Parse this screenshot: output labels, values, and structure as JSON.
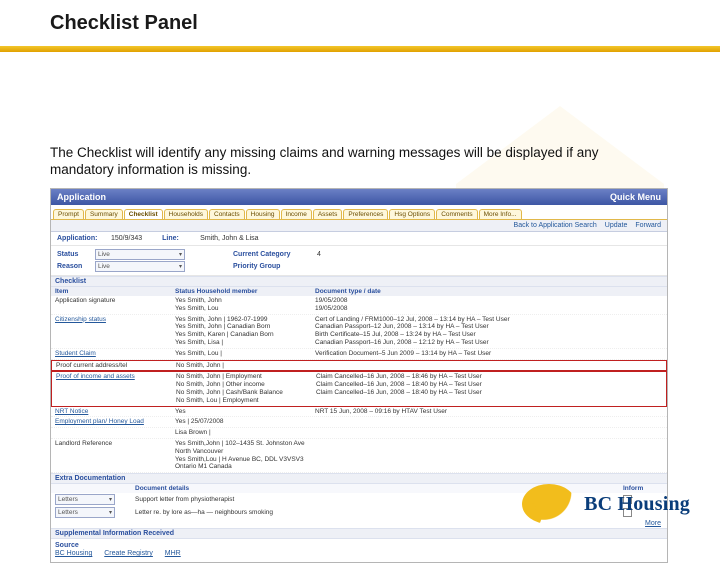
{
  "slide": {
    "title": "Checklist Panel",
    "description": "The Checklist will identify any missing claims and warning messages will be displayed if any mandatory information is missing."
  },
  "app": {
    "header_title": "Application",
    "header_right": "Quick Menu",
    "tabs": [
      "Prompt",
      "Summary",
      "Checklist",
      "Households",
      "Contacts",
      "Housing",
      "Income",
      "Assets",
      "Preferences",
      "Hsg Options",
      "Comments",
      "More Info..."
    ],
    "active_tab_index": 2,
    "actions": {
      "back": "Back to Application Search",
      "update": "Update",
      "forward": "Forward"
    },
    "meta": {
      "application_label": "Application:",
      "application_value": "150/9/343",
      "line_label": "Line:",
      "line_value": "Smith, John & Lisa"
    },
    "status": {
      "status_label": "Status",
      "status_value": "Live",
      "reason_label": "Reason",
      "reason_value": "Live",
      "category_label": "Current Category",
      "category_value": "4",
      "priority_label": "Priority Group"
    },
    "checklist": {
      "title": "Checklist",
      "headers": [
        "Item",
        "Status  Household member",
        "Document type / date"
      ],
      "rows": [
        {
          "item": "Application signature",
          "col2": [
            "Yes     Smith, John",
            "Yes     Smith, Lou"
          ],
          "col3": [
            "19/05/2008",
            "19/05/2008"
          ]
        },
        {
          "item": "Citizenship status",
          "link": true,
          "col2": [
            "Yes     Smith, John | 1962-07-1999",
            "Yes     Smith, John | Canadian Born",
            "Yes     Smith, Karen | Canadian Born",
            "Yes     Smith, Lisa |"
          ],
          "col3": [
            "Cert of Landing / FRM1000–12 Jul, 2008 – 13:14 by  HA – Test User",
            "Canadian Passport–12 Jun, 2008 – 13:14 by  HA – Test User",
            "Birth Certificate–15 Jul, 2008 – 13:24 by  HA – Test User",
            "Canadian Passport–16 Jun, 2008 – 12:12 by  HA – Test User"
          ]
        },
        {
          "item": "Student Claim",
          "link": true,
          "col2": [
            "Yes     Smith, Lou |"
          ],
          "col3": [
            "Verification Document–5 Jun 2009 – 13:14 by  HA – Test User"
          ]
        },
        {
          "item": "Proof current address/tel",
          "highlight": true,
          "col2": [
            "No      Smith, John |"
          ],
          "col3": []
        },
        {
          "item": "Proof of income and assets",
          "link": true,
          "highlight": true,
          "col2": [
            "No      Smith, John | Employment",
            "No      Smith, John | Other income",
            "No      Smith, John | Cash/Bank Balance",
            "No      Smith, Lou | Employment"
          ],
          "col3": [
            "Claim Cancelled–16 Jun, 2008 – 18:46 by  HA – Test User",
            "",
            "Claim Cancelled–16 Jun, 2008 – 18:40 by  HA – Test User",
            "Claim Cancelled–16 Jun, 2008 – 18:40 by  HA – Test User"
          ]
        },
        {
          "item": "NRT Notice",
          "link": true,
          "col2": [
            "Yes"
          ],
          "col3": [
            "NRT     15 Jun, 2008 – 09:16 by  HTAV  Test User"
          ]
        },
        {
          "item": "Employment plan/ Honey Load",
          "link": true,
          "col2": [
            "Yes        | 25/07/2008"
          ],
          "col3": []
        },
        {
          "item": "",
          "col2": [
            "Lisa Brown |"
          ],
          "col3": []
        },
        {
          "item": "Landlord Reference",
          "col2": [
            "Yes     Smith,John | 102–1435 St. Johnston Ave North Vancouver",
            "Yes     Smith,Lou | H Avenue BC, DDL V3VSV3 Ontario M1 Canada"
          ],
          "col3": []
        }
      ]
    },
    "extra_docs": {
      "title": "Extra Documentation",
      "header_doc": "Document details",
      "header_inform": "Inform",
      "rows": [
        {
          "select": "Letters",
          "detail": "Support letter from physiotherapist"
        },
        {
          "select": "Letters",
          "detail": "Letter re. by lore as—ha — neighbours smoking"
        }
      ],
      "more": "More"
    },
    "supplemental": {
      "title": "Supplemental Information Received",
      "source_label": "Source",
      "links": [
        "BC Housing",
        "Create Registry",
        "MHR"
      ]
    }
  },
  "branding": {
    "logo_text": "BC Housing"
  }
}
